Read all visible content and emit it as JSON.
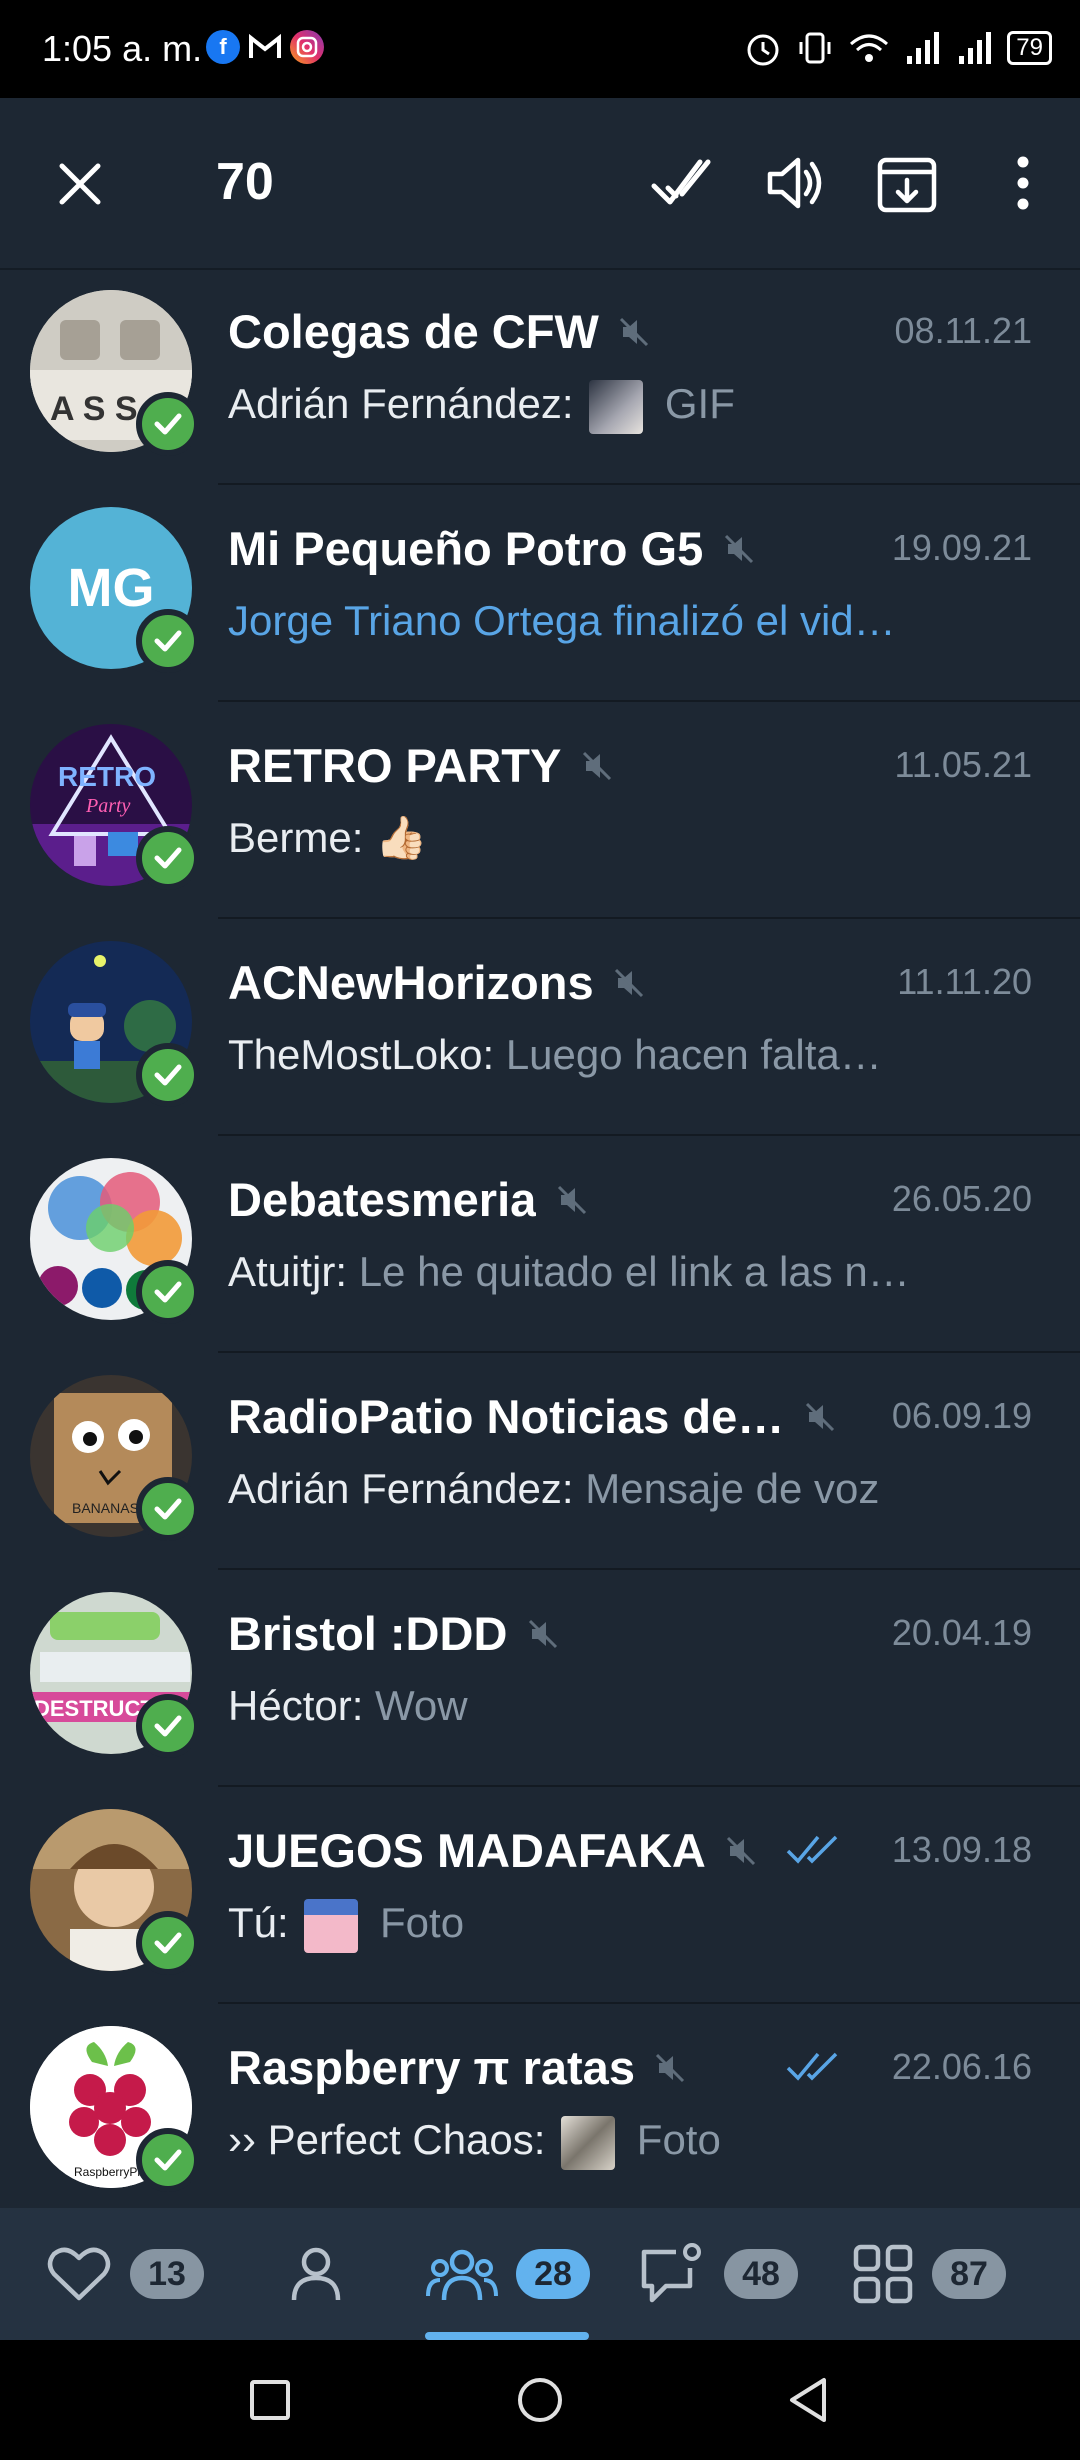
{
  "status_bar": {
    "time": "1:05 a. m.",
    "battery": "79",
    "app_icons": [
      "facebook-icon",
      "gmail-icon",
      "instagram-icon"
    ],
    "system_icons": [
      "alarm-icon",
      "vibrate-icon",
      "wifi-icon",
      "signal-icon",
      "signal-icon-2"
    ]
  },
  "action_bar": {
    "selected_count": "70",
    "actions": [
      "close-icon",
      "mark-read-icon",
      "unmute-icon",
      "archive-icon",
      "more-icon"
    ]
  },
  "chats": [
    {
      "title": "Colegas de CFW",
      "date": "08.11.21",
      "sender": "Adrián Fernández:",
      "thumb": true,
      "message": "GIF",
      "message_style": "grey",
      "read_ticks": false,
      "avatar_color": "#d9d6cf"
    },
    {
      "title": "Mi Pequeño Potro G5",
      "date": "19.09.21",
      "sender": "",
      "thumb": false,
      "message": "Jorge Triano Ortega finalizó el vid…",
      "message_style": "blue",
      "read_ticks": false,
      "avatar_initials": "MG",
      "avatar_color": "#54b3d6"
    },
    {
      "title": "RETRO PARTY",
      "date": "11.05.21",
      "sender": "Berme:",
      "thumb": false,
      "message": "👍🏻",
      "message_style": "grey",
      "read_ticks": false,
      "avatar_color": "#3a1550"
    },
    {
      "title": "ACNewHorizons",
      "date": "11.11.20",
      "sender": "TheMostLoko:",
      "thumb": false,
      "message": "Luego hacen falta…",
      "message_style": "grey",
      "read_ticks": false,
      "avatar_color": "#1e3a6b"
    },
    {
      "title": "Debatesmeria",
      "date": "26.05.20",
      "sender": "Atuitjr:",
      "thumb": false,
      "message": "Le he quitado el link a las n…",
      "message_style": "grey",
      "read_ticks": false,
      "avatar_color": "#d9dde2"
    },
    {
      "title": "RadioPatio Noticias de…",
      "date": "06.09.19",
      "sender": "Adrián Fernández:",
      "thumb": false,
      "message": "Mensaje de voz",
      "message_style": "grey",
      "read_ticks": false,
      "avatar_color": "#8c6a45"
    },
    {
      "title": "Bristol :DDD",
      "date": "20.04.19",
      "sender": "Héctor:",
      "thumb": false,
      "message": "Wow",
      "message_style": "grey",
      "read_ticks": false,
      "avatar_color": "#c9d7cc"
    },
    {
      "title": "JUEGOS MADAFAKA",
      "date": "13.09.18",
      "sender": "Tú:",
      "thumb": true,
      "message": "Foto",
      "message_style": "grey",
      "read_ticks": true,
      "avatar_color": "#b89a78"
    },
    {
      "title": "Raspberry π ratas",
      "date": "22.06.16",
      "sender": "›› Perfect Chaos:",
      "thumb": true,
      "message": "Foto",
      "message_style": "grey",
      "read_ticks": true,
      "avatar_color": "#ffffff"
    }
  ],
  "tabs": [
    {
      "icon": "heart-icon",
      "badge": "13"
    },
    {
      "icon": "person-icon",
      "badge": ""
    },
    {
      "icon": "groups-icon",
      "badge": "28",
      "active": true
    },
    {
      "icon": "chat-bubble-icon",
      "badge": "48"
    },
    {
      "icon": "grid-icon",
      "badge": "87"
    }
  ],
  "colors": {
    "background": "#1d2733",
    "accent": "#62b2ee",
    "check_green": "#4fae4e",
    "date_grey": "#7d8b99"
  }
}
